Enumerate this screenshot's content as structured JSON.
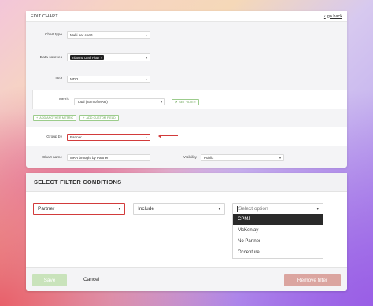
{
  "edit_chart": {
    "title": "EDIT CHART",
    "go_back": "go back",
    "chart_type": {
      "label": "Chart type",
      "value": "Multi bar chart"
    },
    "data_sources": {
      "label": "Data sources",
      "tag": "Inbound Deal Flow"
    },
    "unit": {
      "label": "Unit",
      "value": "MRR"
    },
    "metric": {
      "label": "Metric",
      "value": "Total (sum of MRR)",
      "set_filter": "SET FILTER"
    },
    "add_another_metric": "ADD ANOTHER METRIC",
    "add_custom_field": "ADD CUSTOM FIELD",
    "group_by": {
      "label": "Group by",
      "value": "Partner"
    },
    "chart_name": {
      "label": "Chart name",
      "value": "MRR brought by Partner"
    },
    "visibility": {
      "label": "Visibility",
      "value": "Public"
    }
  },
  "filter": {
    "title": "SELECT FILTER CONDITIONS",
    "field": "Partner",
    "operator": "Include",
    "value_placeholder": "Select option",
    "options": [
      "CPMJ",
      "McKenlay",
      "No Partner",
      "Occenture"
    ],
    "active_option_index": 0
  },
  "footer": {
    "save": "Save",
    "cancel": "Cancel",
    "remove_filter": "Remove filter"
  },
  "colors": {
    "highlight_red": "#d23b3b",
    "save_green": "#c9e3bb",
    "remove_red": "#dba5a0",
    "accent_green": "#6aa457"
  }
}
